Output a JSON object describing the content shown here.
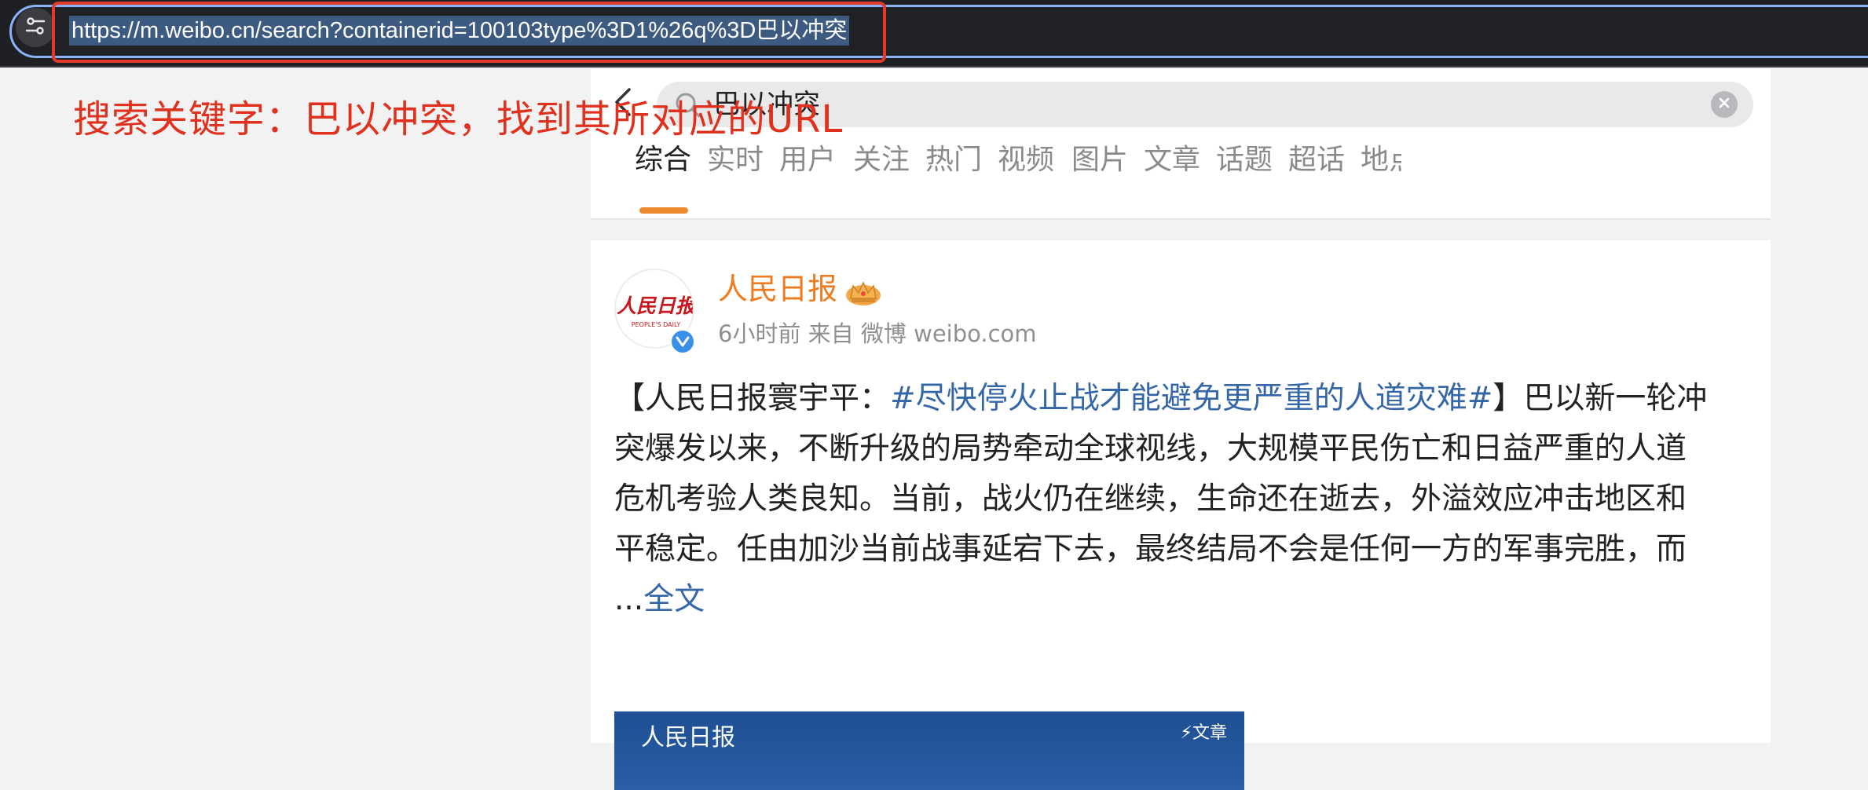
{
  "browser": {
    "url": "https://m.weibo.cn/search?containerid=100103type%3D1%26q%3D巴以冲突",
    "site_info_icon": "tune-icon"
  },
  "annotation": "搜索关键字：巴以冲突，找到其所对应的URL",
  "search": {
    "query": "巴以冲突"
  },
  "tabs": [
    {
      "label": "综合",
      "active": true
    },
    {
      "label": "实时"
    },
    {
      "label": "用户"
    },
    {
      "label": "关注"
    },
    {
      "label": "热门"
    },
    {
      "label": "视频"
    },
    {
      "label": "图片"
    },
    {
      "label": "文章"
    },
    {
      "label": "话题"
    },
    {
      "label": "超话"
    },
    {
      "label": "地点"
    }
  ],
  "post": {
    "author": "人民日报",
    "meta": "6小时前 来自 微博 weibo.com",
    "text_prefix": "【人民日报寰宇平：",
    "hashtag": "#尽快停火止战才能避免更严重的人道灾难#",
    "text_body": "】巴以新一轮冲突爆发以来，不断升级的局势牵动全球视线，大规模平民伤亡和日益严重的人道危机考验人类良知。当前，战火仍在继续，生命还在逝去，外溢效应冲击地区和平稳定。任由加沙当前战事延宕下去，最终结局不会是任何一方的军事完胜，而 ...",
    "more_link": "全文",
    "avatar_logo_text": "人民日报",
    "avatar_logo_sub": "PEOPLE'S DAILY",
    "thumbnail": {
      "source": "人民日报",
      "badge": "文章"
    }
  },
  "colors": {
    "accent": "#ee8a2e",
    "author": "#ee7b1f",
    "link": "#3566a8",
    "annotation": "#e0301e",
    "url_highlight_border": "#e03a2d"
  }
}
